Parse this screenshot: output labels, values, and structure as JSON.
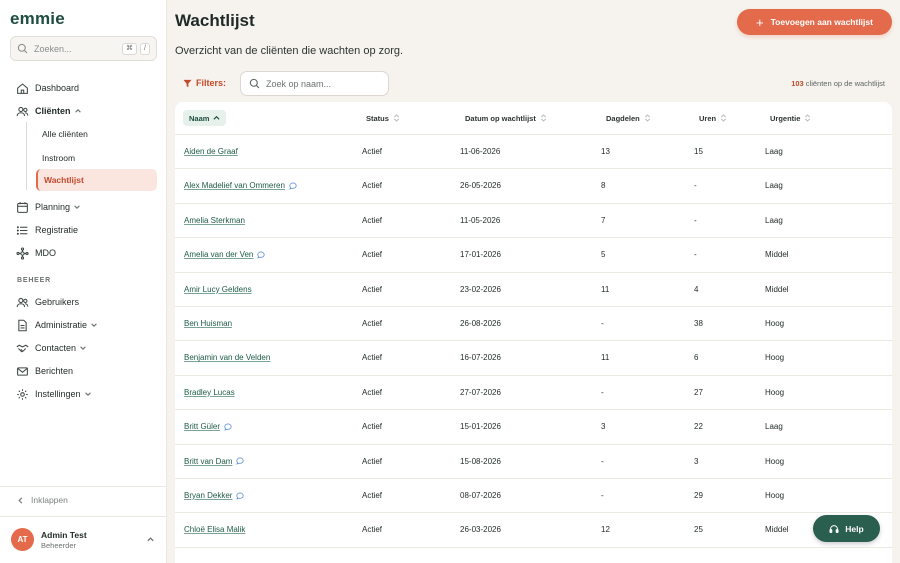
{
  "app": {
    "logo": "emmie"
  },
  "sidebar": {
    "search_placeholder": "Zoeken...",
    "shortcut_1": "⌘",
    "shortcut_2": "/",
    "items": [
      {
        "label": "Dashboard",
        "icon": "home-icon"
      },
      {
        "label": "Cliënten",
        "icon": "users-icon",
        "expanded": true
      },
      {
        "label": "Planning",
        "icon": "calendar-icon"
      },
      {
        "label": "Registratie",
        "icon": "list-icon"
      },
      {
        "label": "MDO",
        "icon": "network-icon"
      }
    ],
    "client_subitems": [
      {
        "label": "Alle cliënten"
      },
      {
        "label": "Instroom"
      },
      {
        "label": "Wachtlijst",
        "active": true
      }
    ],
    "section_label": "BEHEER",
    "beheer_items": [
      {
        "label": "Gebruikers",
        "icon": "users-icon"
      },
      {
        "label": "Administratie",
        "icon": "document-icon"
      },
      {
        "label": "Contacten",
        "icon": "handshake-icon"
      },
      {
        "label": "Berichten",
        "icon": "mail-icon"
      },
      {
        "label": "Instellingen",
        "icon": "gear-icon"
      }
    ],
    "collapse_label": "Inklappen",
    "user": {
      "initials": "AT",
      "name": "Admin Test",
      "role": "Beheerder"
    }
  },
  "main": {
    "title": "Wachtlijst",
    "subtitle": "Overzicht van de cliënten die wachten op zorg.",
    "add_button": "Toevoegen aan wachtlijst",
    "filters_label": "Filters:",
    "search_placeholder": "Zoek op naam...",
    "count_number": "103",
    "count_suffix": " cliënten op de wachtlijst",
    "help_label": "Help"
  },
  "table": {
    "columns": [
      "Naam",
      "Status",
      "Datum op wachtlijst",
      "Dagdelen",
      "Uren",
      "Urgentie"
    ],
    "rows": [
      {
        "naam": "Aiden de Graaf",
        "msg": false,
        "status": "Actief",
        "datum": "11-06-2026",
        "dagdelen": "13",
        "uren": "15",
        "urgentie": "Laag"
      },
      {
        "naam": "Alex Madelief van Ommeren",
        "msg": true,
        "status": "Actief",
        "datum": "26-05-2026",
        "dagdelen": "8",
        "uren": "-",
        "urgentie": "Laag"
      },
      {
        "naam": "Amelia Sterkman",
        "msg": false,
        "status": "Actief",
        "datum": "11-05-2026",
        "dagdelen": "7",
        "uren": "-",
        "urgentie": "Laag"
      },
      {
        "naam": "Amelia van der Ven",
        "msg": true,
        "status": "Actief",
        "datum": "17-01-2026",
        "dagdelen": "5",
        "uren": "-",
        "urgentie": "Middel"
      },
      {
        "naam": "Amir Lucy Geldens",
        "msg": false,
        "status": "Actief",
        "datum": "23-02-2026",
        "dagdelen": "11",
        "uren": "4",
        "urgentie": "Middel"
      },
      {
        "naam": "Ben Huisman",
        "msg": false,
        "status": "Actief",
        "datum": "26-08-2026",
        "dagdelen": "-",
        "uren": "38",
        "urgentie": "Hoog"
      },
      {
        "naam": "Benjamin van de Velden",
        "msg": false,
        "status": "Actief",
        "datum": "16-07-2026",
        "dagdelen": "11",
        "uren": "6",
        "urgentie": "Hoog"
      },
      {
        "naam": "Bradley Lucas",
        "msg": false,
        "status": "Actief",
        "datum": "27-07-2026",
        "dagdelen": "-",
        "uren": "27",
        "urgentie": "Hoog"
      },
      {
        "naam": "Britt Güler",
        "msg": true,
        "status": "Actief",
        "datum": "15-01-2026",
        "dagdelen": "3",
        "uren": "22",
        "urgentie": "Laag"
      },
      {
        "naam": "Britt van Dam",
        "msg": true,
        "status": "Actief",
        "datum": "15-08-2026",
        "dagdelen": "-",
        "uren": "3",
        "urgentie": "Hoog"
      },
      {
        "naam": "Bryan Dekker",
        "msg": true,
        "status": "Actief",
        "datum": "08-07-2026",
        "dagdelen": "-",
        "uren": "29",
        "urgentie": "Hoog"
      },
      {
        "naam": "Chloë Elisa Malik",
        "msg": false,
        "status": "Actief",
        "datum": "26-03-2026",
        "dagdelen": "12",
        "uren": "25",
        "urgentie": "Middel"
      }
    ]
  },
  "colors": {
    "accent": "#e36a4a",
    "brand": "#1e4d40",
    "help": "#2a5e4f"
  }
}
